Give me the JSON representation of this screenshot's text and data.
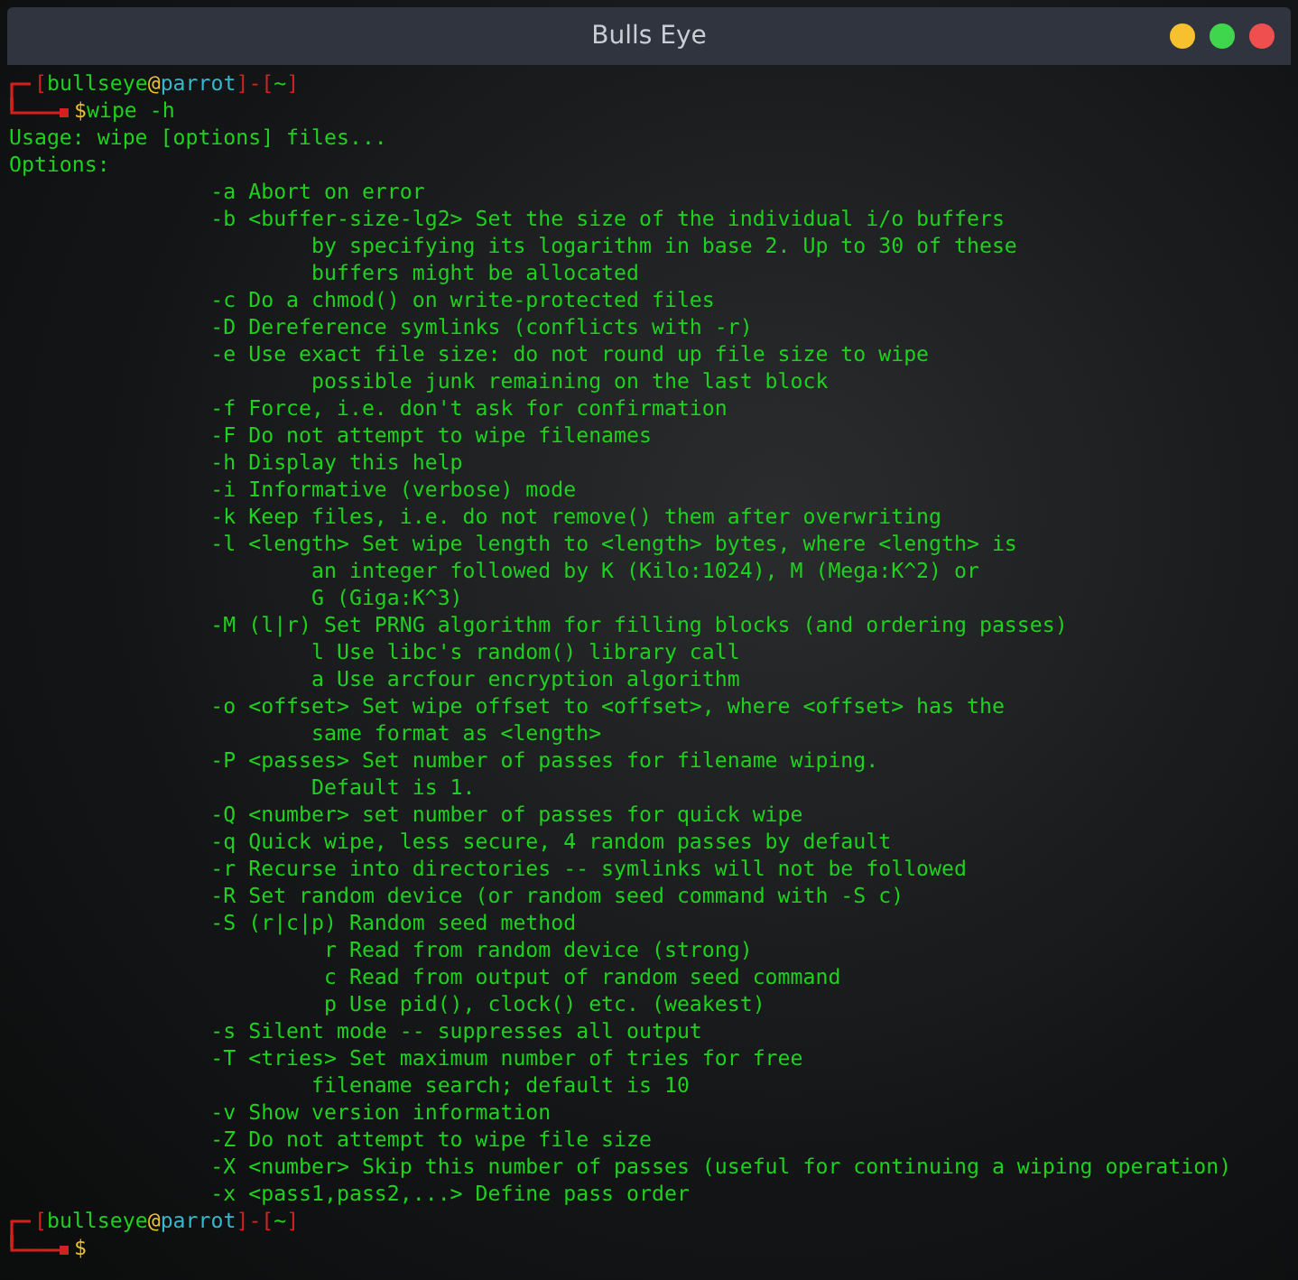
{
  "window": {
    "title": "Bulls Eye",
    "controls": [
      {
        "kind": "minimize"
      },
      {
        "kind": "maximize"
      },
      {
        "kind": "close"
      }
    ]
  },
  "terminal": {
    "prompt": {
      "segments": [
        {
          "kind": "bracket",
          "text": "["
        },
        {
          "kind": "user",
          "text": "bullseye"
        },
        {
          "kind": "at",
          "text": "@"
        },
        {
          "kind": "host",
          "text": "parrot"
        },
        {
          "kind": "bracket",
          "text": "]"
        },
        {
          "kind": "bracket",
          "text": "-"
        },
        {
          "kind": "bracket",
          "text": "["
        },
        {
          "kind": "dir",
          "text": "~"
        },
        {
          "kind": "bracket",
          "text": "]"
        }
      ],
      "symbol": "$",
      "command": "wipe -h"
    },
    "output": [
      "Usage: wipe [options] files...",
      "Options:",
      "                -a Abort on error",
      "                -b <buffer-size-lg2> Set the size of the individual i/o buffers",
      "                        by specifying its logarithm in base 2. Up to 30 of these",
      "                        buffers might be allocated",
      "                -c Do a chmod() on write-protected files",
      "                -D Dereference symlinks (conflicts with -r)",
      "                -e Use exact file size: do not round up file size to wipe",
      "                        possible junk remaining on the last block",
      "                -f Force, i.e. don't ask for confirmation",
      "                -F Do not attempt to wipe filenames",
      "                -h Display this help",
      "                -i Informative (verbose) mode",
      "                -k Keep files, i.e. do not remove() them after overwriting",
      "                -l <length> Set wipe length to <length> bytes, where <length> is",
      "                        an integer followed by K (Kilo:1024), M (Mega:K^2) or",
      "                        G (Giga:K^3)",
      "                -M (l|r) Set PRNG algorithm for filling blocks (and ordering passes)",
      "                        l Use libc's random() library call",
      "                        a Use arcfour encryption algorithm",
      "                -o <offset> Set wipe offset to <offset>, where <offset> has the",
      "                        same format as <length>",
      "                -P <passes> Set number of passes for filename wiping.",
      "                        Default is 1.",
      "                -Q <number> set number of passes for quick wipe",
      "                -q Quick wipe, less secure, 4 random passes by default",
      "                -r Recurse into directories -- symlinks will not be followed",
      "                -R Set random device (or random seed command with -S c)",
      "                -S (r|c|p) Random seed method",
      "                         r Read from random device (strong)",
      "                         c Read from output of random seed command",
      "                         p Use pid(), clock() etc. (weakest)",
      "                -s Silent mode -- suppresses all output",
      "                -T <tries> Set maximum number of tries for free",
      "                        filename search; default is 10",
      "                -v Show version information",
      "                -Z Do not attempt to wipe file size",
      "                -X <number> Skip this number of passes (useful for continuing a wiping operation)",
      "                -x <pass1,pass2,...> Define pass order"
    ],
    "next_prompt": {
      "segments": [
        {
          "kind": "bracket",
          "text": "["
        },
        {
          "kind": "user",
          "text": "bullseye"
        },
        {
          "kind": "at",
          "text": "@"
        },
        {
          "kind": "host",
          "text": "parrot"
        },
        {
          "kind": "bracket",
          "text": "]"
        },
        {
          "kind": "bracket",
          "text": "-"
        },
        {
          "kind": "bracket",
          "text": "["
        },
        {
          "kind": "dir",
          "text": "~"
        },
        {
          "kind": "bracket",
          "text": "]"
        }
      ],
      "symbol": "$"
    }
  }
}
